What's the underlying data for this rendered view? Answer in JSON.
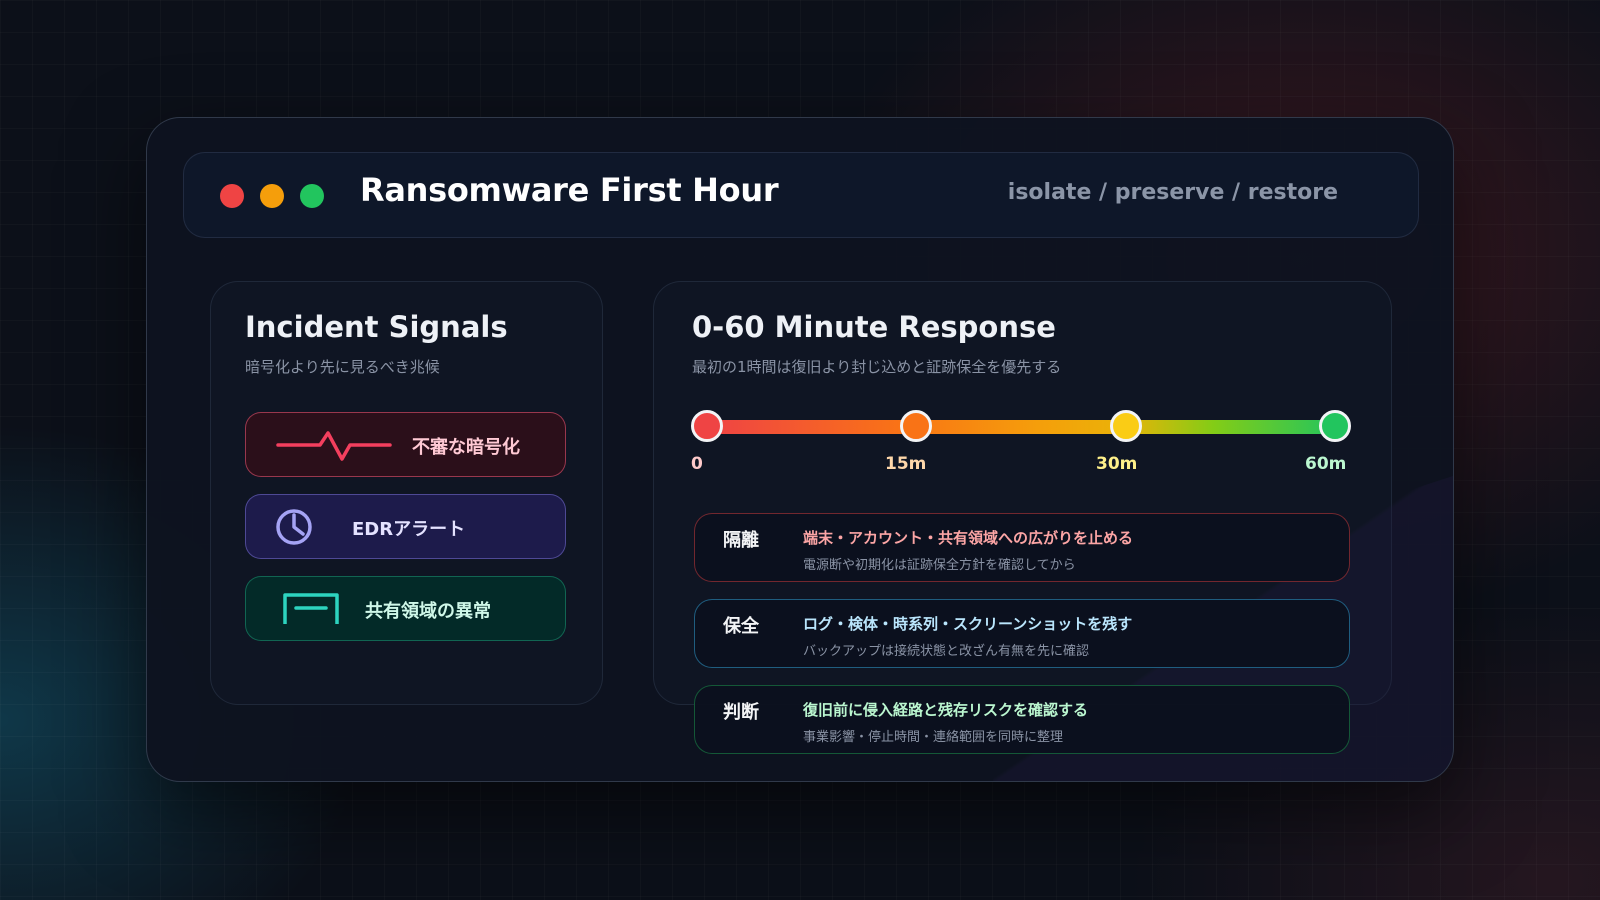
{
  "window": {
    "title": "Ransomware First Hour",
    "tagline": "isolate / preserve / restore"
  },
  "signals": {
    "title": "Incident Signals",
    "subtitle": "暗号化より先に見るべき兆候",
    "items": [
      {
        "label": "不審な暗号化",
        "icon": "pulse-icon",
        "accent": "#f43f5e"
      },
      {
        "label": "EDRアラート",
        "icon": "clock-icon",
        "accent": "#a5a3f5"
      },
      {
        "label": "共有領域の異常",
        "icon": "share-tray-icon",
        "accent": "#2dd4bf"
      }
    ]
  },
  "response": {
    "title": "0-60 Minute Response",
    "subtitle": "最初の1時間は復旧より封じ込めと証跡保全を優先する",
    "timeline": [
      {
        "label": "0",
        "color": "#ef4444",
        "label_color": "#fecaca"
      },
      {
        "label": "15m",
        "color": "#f97316",
        "label_color": "#fed7aa"
      },
      {
        "label": "30m",
        "color": "#facc15",
        "label_color": "#fef08a"
      },
      {
        "label": "60m",
        "color": "#22c55e",
        "label_color": "#bbf7d0"
      }
    ],
    "steps": [
      {
        "tag": "隔離",
        "main": "端末・アカウント・共有領域への広がりを止める",
        "note": "電源断や初期化は証跡保全方針を確認してから",
        "accent": "#ef4444"
      },
      {
        "tag": "保全",
        "main": "ログ・検体・時系列・スクリーンショットを残す",
        "note": "バックアップは接続状態と改ざん有無を先に確認",
        "accent": "#38bdf8"
      },
      {
        "tag": "判断",
        "main": "復旧前に侵入経路と残存リスクを確認する",
        "note": "事業影響・停止時間・連絡範囲を同時に整理",
        "accent": "#22c55e"
      }
    ]
  }
}
